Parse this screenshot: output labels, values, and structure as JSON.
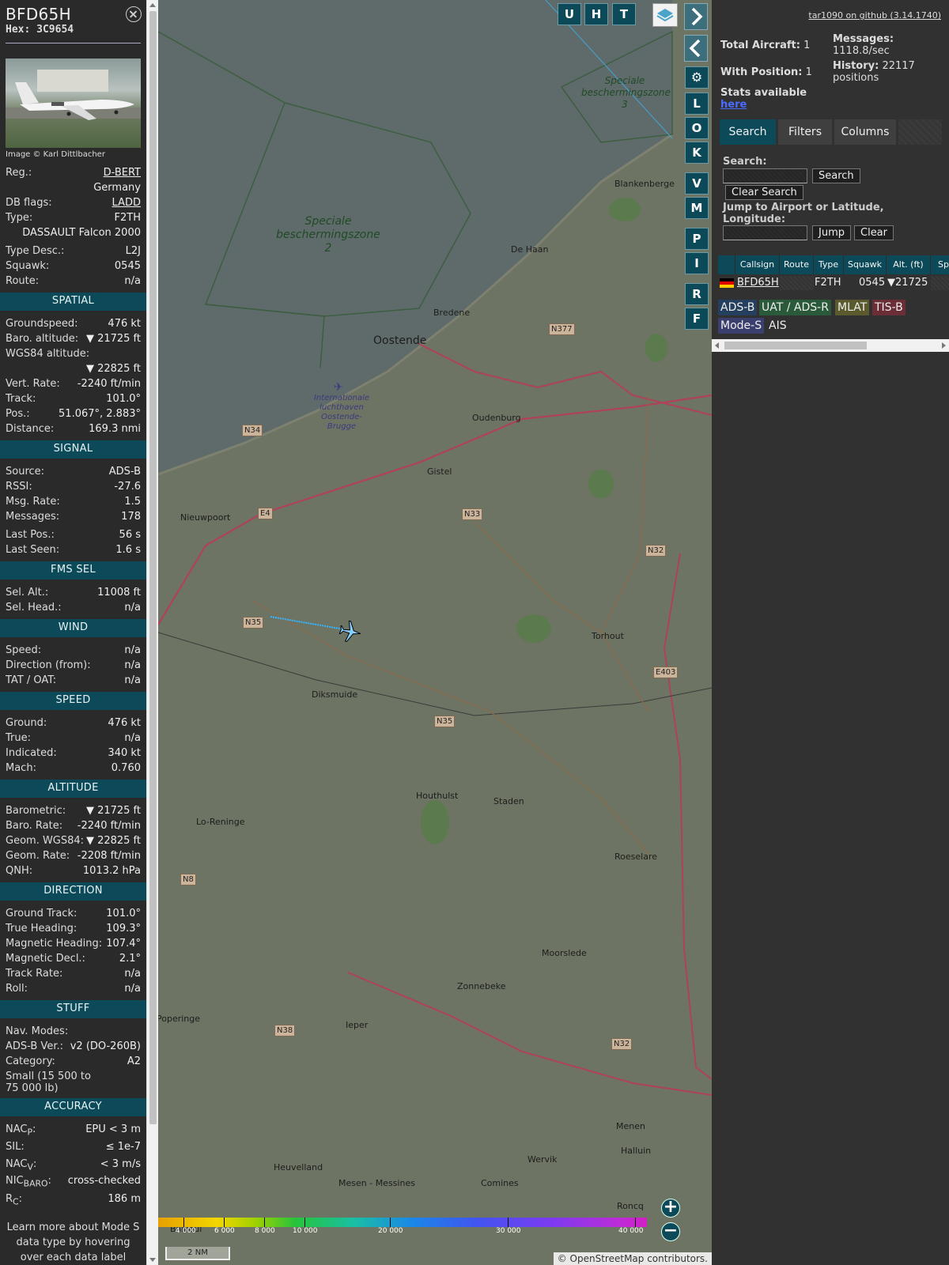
{
  "detail": {
    "callsign": "BFD65H",
    "hex": "Hex: 3C9654",
    "image_credit": "Image © Karl Dittlbacher",
    "reg_label": "Reg.:",
    "reg": "D-BERT",
    "country": "Germany",
    "dbflags_label": "DB flags:",
    "dbflags": "LADD",
    "type_label": "Type:",
    "type": "F2TH",
    "type_full": "DASSAULT Falcon 2000",
    "typedesc_label": "Type Desc.:",
    "typedesc": "L2J",
    "squawk_label": "Squawk:",
    "squawk": "0545",
    "route_label": "Route:",
    "route": "n/a",
    "spatial": {
      "title": "SPATIAL",
      "groundspeed_label": "Groundspeed:",
      "groundspeed": "476 kt",
      "baro_label": "Baro. altitude:",
      "baro": "▼ 21725 ft",
      "wgs_label": "WGS84 altitude:",
      "wgs": "▼ 22825 ft",
      "vrate_label": "Vert. Rate:",
      "vrate": "-2240 ft/min",
      "track_label": "Track:",
      "track": "101.0°",
      "pos_label": "Pos.:",
      "pos": "51.067°, 2.883°",
      "distance_label": "Distance:",
      "distance": "169.3 nmi"
    },
    "signal": {
      "title": "SIGNAL",
      "source_label": "Source:",
      "source": "ADS-B",
      "rssi_label": "RSSI:",
      "rssi": "-27.6",
      "msgrate_label": "Msg. Rate:",
      "msgrate": "1.5",
      "messages_label": "Messages:",
      "messages": "178",
      "lastpos_label": "Last Pos.:",
      "lastpos": "56 s",
      "lastseen_label": "Last Seen:",
      "lastseen": "1.6 s"
    },
    "fms": {
      "title": "FMS SEL",
      "selalt_label": "Sel. Alt.:",
      "selalt": "11008 ft",
      "selhead_label": "Sel. Head.:",
      "selhead": "n/a"
    },
    "wind": {
      "title": "WIND",
      "speed_label": "Speed:",
      "speed": "n/a",
      "dir_label": "Direction (from):",
      "dir": "n/a",
      "tat_label": "TAT / OAT:",
      "tat": "n/a"
    },
    "speed": {
      "title": "SPEED",
      "ground_label": "Ground:",
      "ground": "476 kt",
      "true_label": "True:",
      "true": "n/a",
      "ias_label": "Indicated:",
      "ias": "340 kt",
      "mach_label": "Mach:",
      "mach": "0.760"
    },
    "altitude": {
      "title": "ALTITUDE",
      "baro_label": "Barometric:",
      "baro": "▼ 21725 ft",
      "barorate_label": "Baro. Rate:",
      "barorate": "-2240 ft/min",
      "geom_label": "Geom. WGS84:",
      "geom": "▼ 22825 ft",
      "geomrate_label": "Geom. Rate:",
      "geomrate": "-2208 ft/min",
      "qnh_label": "QNH:",
      "qnh": "1013.2 hPa"
    },
    "direction": {
      "title": "DIRECTION",
      "gtrack_label": "Ground Track:",
      "gtrack": "101.0°",
      "thead_label": "True Heading:",
      "thead": "109.3°",
      "mhead_label": "Magnetic Heading:",
      "mhead": "107.4°",
      "mdecl_label": "Magnetic Decl.:",
      "mdecl": "2.1°",
      "trate_label": "Track Rate:",
      "trate": "n/a",
      "roll_label": "Roll:",
      "roll": "n/a"
    },
    "stuff": {
      "title": "STUFF",
      "navmodes_label": "Nav. Modes:",
      "adsbver_label": "ADS-B Ver.:",
      "adsbver": "v2 (DO-260B)",
      "category_label": "Category:",
      "category": "A2",
      "category_desc": "Small (15 500 to 75 000 lb)"
    },
    "accuracy": {
      "title": "ACCURACY",
      "nacp_label": "NAC",
      "nacp_sub": "P",
      "nacp": "EPU < 3 m",
      "sil_label": "SIL:",
      "sil": "≤ 1e-7",
      "nacv_label": "NAC",
      "nacv_sub": "V",
      "nacv": "< 3 m/s",
      "nicbaro_label": "NIC",
      "nicbaro_sub": "BARO",
      "nicbaro": "cross-checked",
      "rc_label": "R",
      "rc_sub": "C",
      "rc": "186 m"
    },
    "learn_more": "Learn more about Mode S data type by hovering over each data label"
  },
  "map": {
    "toggles_top": [
      "U",
      "H",
      "T"
    ],
    "toggles_side": [
      "L",
      "O",
      "K",
      "V",
      "M",
      "P",
      "I",
      "R",
      "F"
    ],
    "places": {
      "blankenberge": "Blankenberge",
      "dehaan": "De Haan",
      "bredene": "Bredene",
      "oostende": "Oostende",
      "oudenburg": "Oudenburg",
      "gistel": "Gistel",
      "nieuwpoort": "Nieuwpoort",
      "torhout": "Torhout",
      "diksmuide": "Diksmuide",
      "houthulst": "Houthulst",
      "staden": "Staden",
      "loreninge": "Lo-Reninge",
      "roeselare": "Roeselare",
      "moorslede": "Moorslede",
      "zonnebeke": "Zonnebeke",
      "poperinge": "Poperinge",
      "ieper": "Ieper",
      "heuvelland": "Heuvelland",
      "menen": "Menen",
      "halluin": "Halluin",
      "wervik": "Wervik",
      "mesen": "Mesen - Messines",
      "comines": "Comines",
      "roncq": "Roncq",
      "bailleul": "Bailleul"
    },
    "zone2": "Speciale beschermingszone 2",
    "zone3": "Speciale beschermingszone 3",
    "airport": "Internationale luchthaven Oostende-Brugge",
    "roads": {
      "n377": "N377",
      "n34": "N34",
      "n33": "N33",
      "n32": "N32",
      "n35a": "N35",
      "n35b": "N35",
      "e403": "E403",
      "n8": "N8",
      "n38": "N38",
      "n32b": "N32",
      "e40": "E4"
    },
    "altitude_ticks": [
      "4 000",
      "6 000",
      "8 000",
      "10 000",
      "20 000",
      "30 000",
      "40 000"
    ],
    "scale": "2 NM",
    "zoom_in": "+",
    "zoom_out": "−",
    "attribution": "© OpenStreetMap contributors."
  },
  "sidebar": {
    "github": "tar1090 on github (3.14.1740)",
    "total_aircraft_label": "Total Aircraft:",
    "total_aircraft": "1",
    "with_position_label": "With Position:",
    "with_position": "1",
    "messages_label": "Messages:",
    "messages": "1118.8/sec",
    "history_label": "History:",
    "history": "22117 positions",
    "stats_text": "Stats available",
    "stats_link": "here",
    "tabs": [
      "Search",
      "Filters",
      "Columns"
    ],
    "search_label": "Search:",
    "search_btn": "Search",
    "clear_search_btn": "Clear Search",
    "jump_label": "Jump to Airport or Latitude, Longitude:",
    "jump_btn": "Jump",
    "clear_btn": "Clear",
    "columns": [
      "Callsign",
      "Route",
      "Type",
      "Squawk",
      "Alt. (ft)",
      "Spd"
    ],
    "rows": [
      {
        "callsign": "BFD65H",
        "route": "",
        "type": "F2TH",
        "squawk": "0545",
        "alt": "▼21725"
      }
    ],
    "sources": [
      "ADS-B",
      "UAT / ADS-R",
      "MLAT",
      "TIS-B",
      "Mode-S",
      "AIS"
    ],
    "source_colors": [
      "#25405f",
      "#2a5a3a",
      "#5a5a2e",
      "#6b2d36",
      "#3b3f6e",
      "#313131"
    ]
  }
}
